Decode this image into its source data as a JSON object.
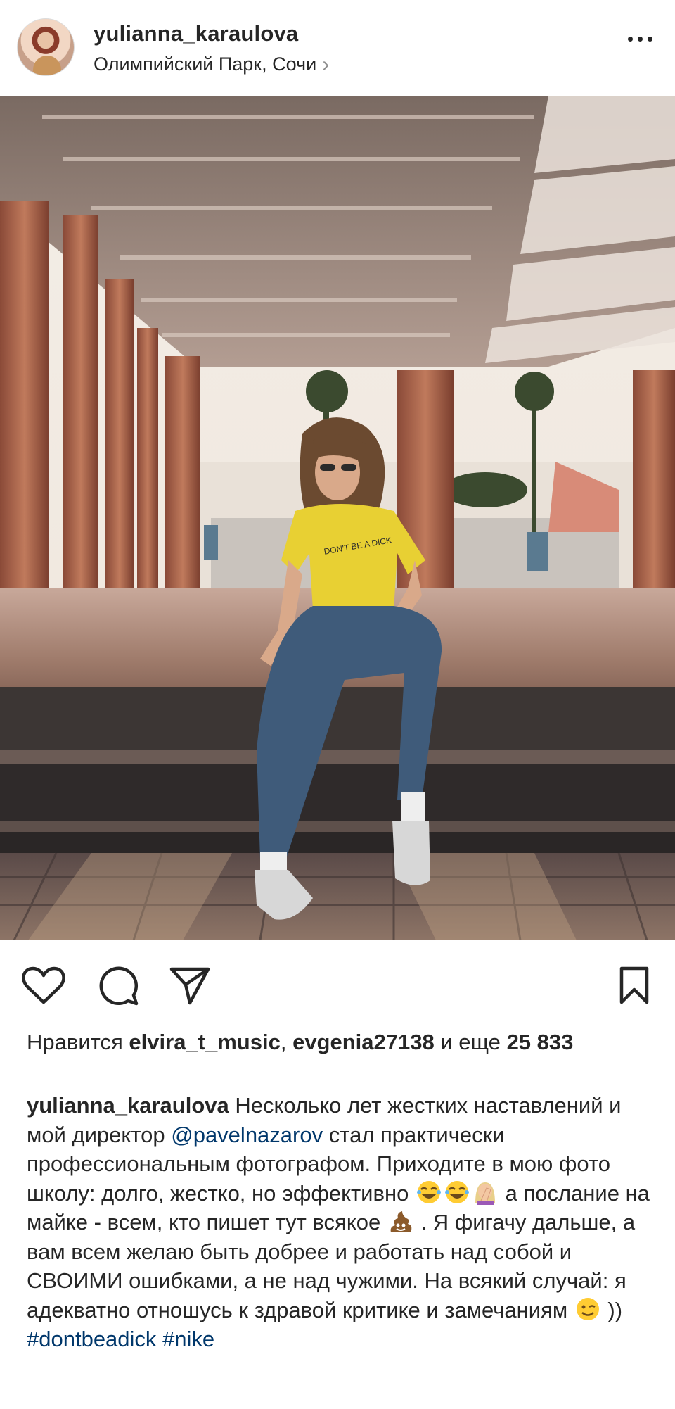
{
  "header": {
    "username": "yulianna_karaulova",
    "location": "Олимпийский Парк, Сочи",
    "location_chevron": "›"
  },
  "photo": {
    "shirt_text": "DON'T BE A DICK"
  },
  "actions": {
    "icons": [
      "heart-icon",
      "comment-icon",
      "share-icon",
      "bookmark-icon"
    ]
  },
  "likes": {
    "prefix": "Нравится",
    "user1": "elvira_t_music",
    "sep": ", ",
    "user2": "evgenia27138",
    "and_more": "и еще",
    "count": "25 833"
  },
  "caption": {
    "username": "yulianna_karaulova",
    "part1": " Несколько лет жестких наставлений и мой директор ",
    "mention": "@pavelnazarov",
    "part2": " стал практически профессиональным фотографом. Приходите в мою фото школу: долго, жестко, но эффективно ",
    "part3": "  а послание на майке - всем, кто пишет тут всякое ",
    "part4": " . Я фигачу дальше, а вам всем желаю быть добрее и работать над собой и СВОИМИ ошибками, а не над чужими. На всякий случай:  я адекватно отношусь к здравой критике и замечаниям ",
    "part5": " )) ",
    "hashtag1": "#dontbeadick",
    "hashtag2": "#nike"
  },
  "colors": {
    "text": "#262626",
    "link": "#00376b",
    "shirt": "#e8d033"
  }
}
